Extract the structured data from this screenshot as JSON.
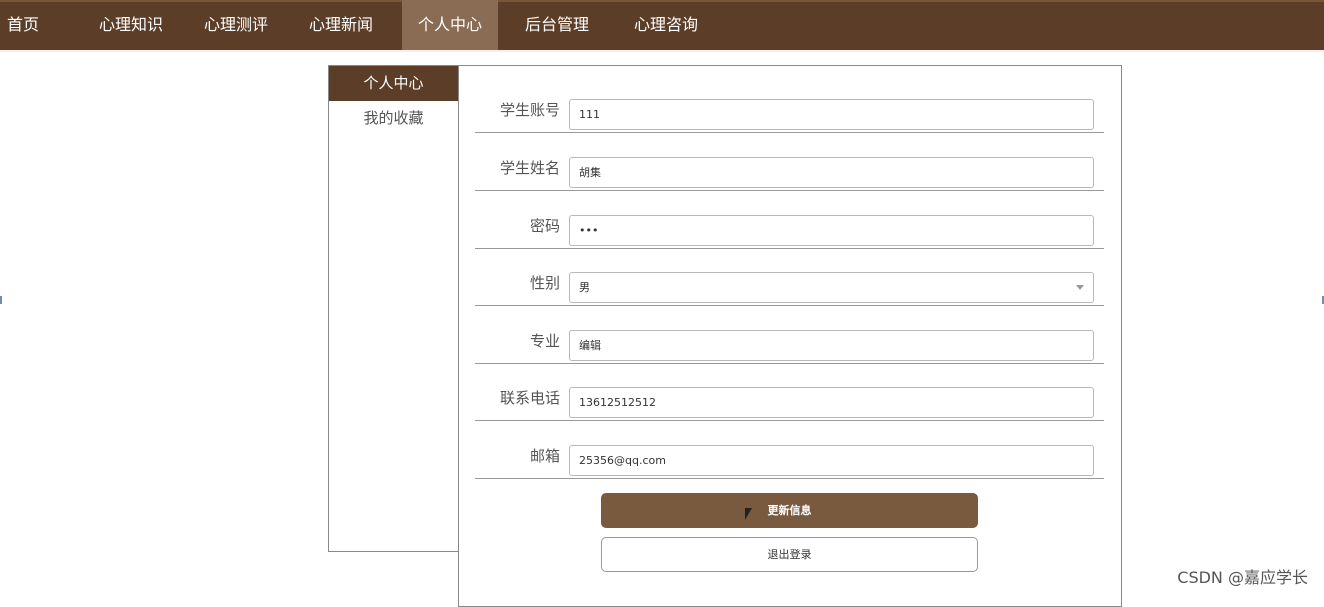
{
  "nav": {
    "items": [
      {
        "label": "首页"
      },
      {
        "label": "心理知识"
      },
      {
        "label": "心理测评"
      },
      {
        "label": "心理新闻"
      },
      {
        "label": "个人中心"
      },
      {
        "label": "后台管理"
      },
      {
        "label": "心理咨询"
      }
    ],
    "active_index": 4,
    "colors": {
      "bar": "#5c3e28",
      "active": "#8a6c54"
    }
  },
  "side_menu": {
    "items": [
      {
        "label": "个人中心"
      },
      {
        "label": "我的收藏"
      }
    ],
    "active_index": 0
  },
  "form": {
    "fields": [
      {
        "label": "学生账号",
        "value": "111"
      },
      {
        "label": "学生姓名",
        "value": "胡集"
      },
      {
        "label": "密码",
        "value": "•••"
      },
      {
        "label": "性别",
        "value": "男"
      },
      {
        "label": "专业",
        "value": "编辑"
      },
      {
        "label": "联系电话",
        "value": "13612512512"
      },
      {
        "label": "邮箱",
        "value": "25356@qq.com"
      }
    ],
    "update_label": "更新信息",
    "logout_label": "退出登录"
  },
  "icons": {
    "select_caret": "chevron-down-icon",
    "cursor": "mouse-pointer-icon"
  },
  "watermark": "CSDN @嘉应学长"
}
